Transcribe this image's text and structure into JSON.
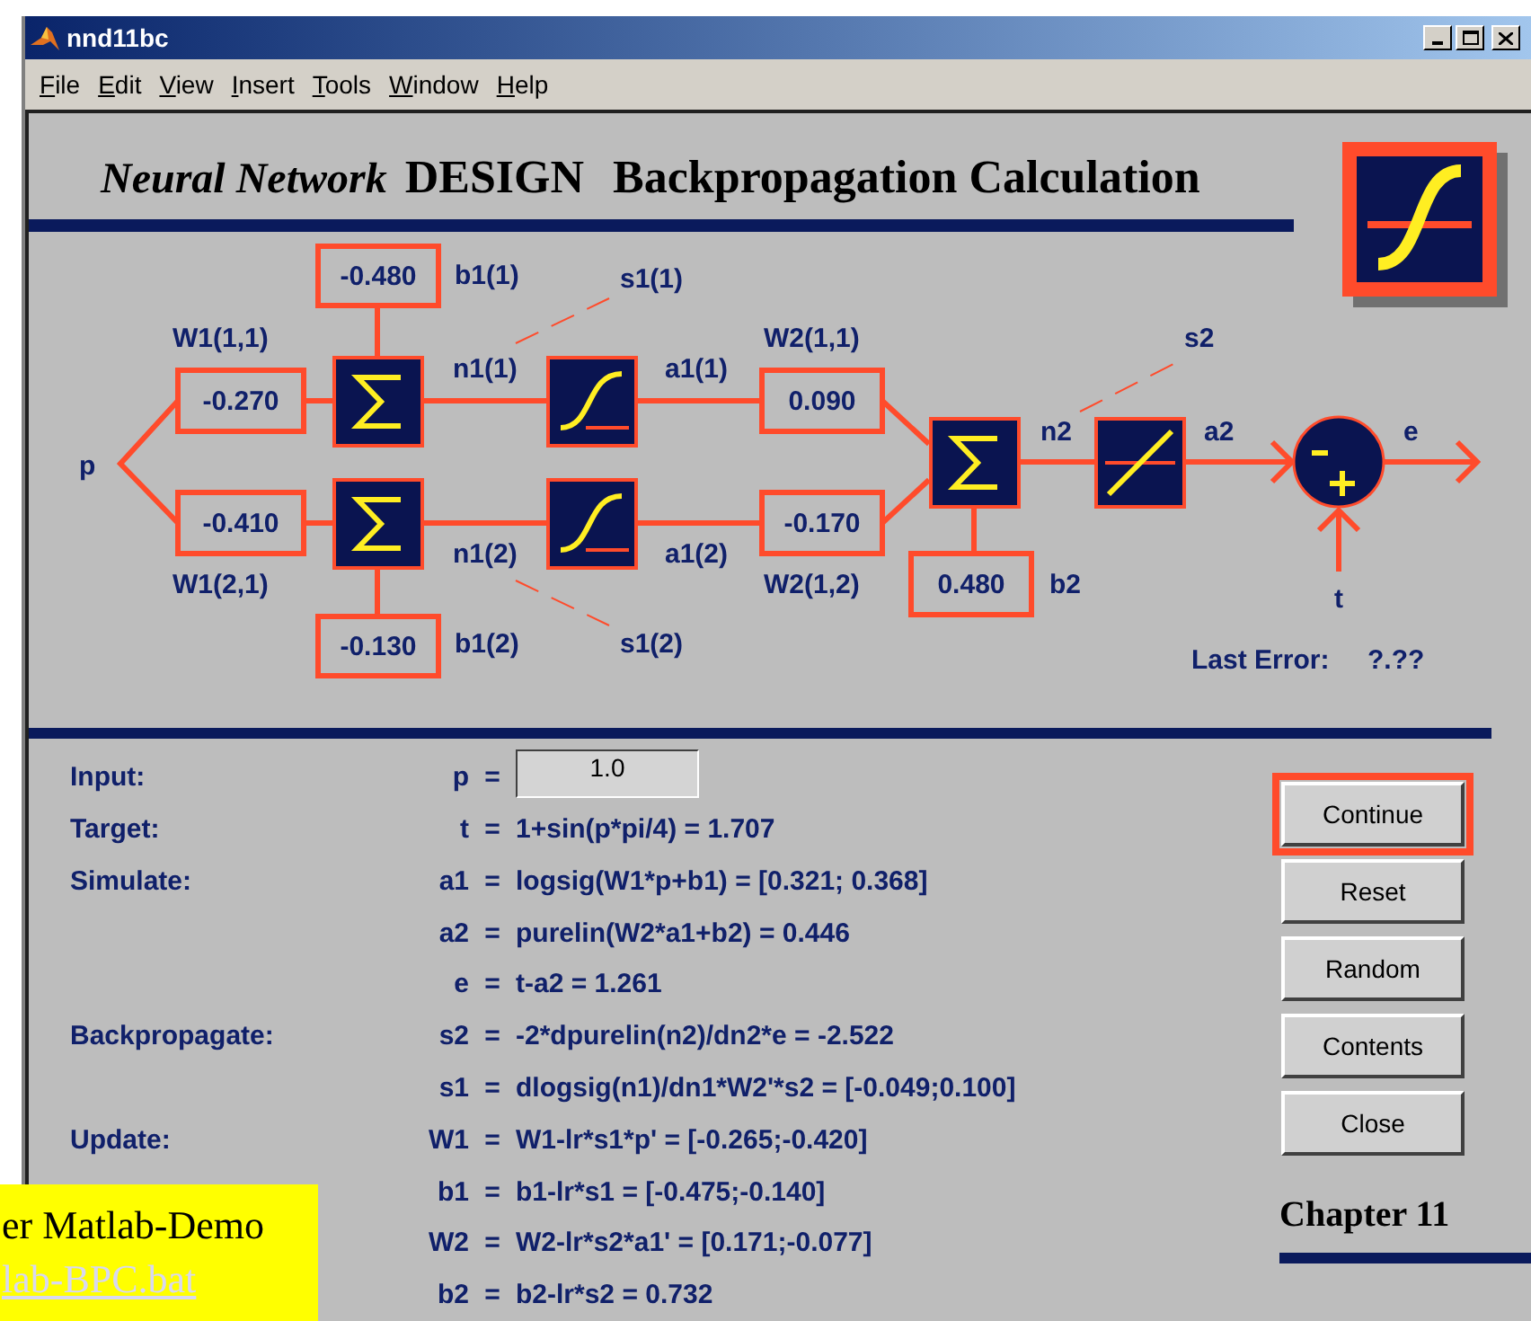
{
  "window": {
    "title": "nnd11bc"
  },
  "menu": [
    {
      "label": "File"
    },
    {
      "label": "Edit"
    },
    {
      "label": "View"
    },
    {
      "label": "Insert"
    },
    {
      "label": "Tools"
    },
    {
      "label": "Window"
    },
    {
      "label": "Help"
    }
  ],
  "header": {
    "title_italic": "Neural Network",
    "title_brand": "DESIGN",
    "subtitle": "Backpropagation Calculation"
  },
  "diagram": {
    "input_label": "p",
    "layer1": [
      {
        "weight_label": "W1(1,1)",
        "weight": "-0.270",
        "bias": "-0.480",
        "bias_label": "b1(1)",
        "net_label": "n1(1)",
        "sensitivity_label": "s1(1)",
        "output_label": "a1(1)"
      },
      {
        "weight_label": "W1(2,1)",
        "weight": "-0.410",
        "bias": "-0.130",
        "bias_label": "b1(2)",
        "net_label": "n1(2)",
        "sensitivity_label": "s1(2)",
        "output_label": "a1(2)"
      }
    ],
    "layer2": {
      "weights": [
        {
          "label": "W2(1,1)",
          "value": "0.090"
        },
        {
          "label": "W2(1,2)",
          "value": "-0.170"
        }
      ],
      "bias": "0.480",
      "bias_label": "b2",
      "net_label": "n2",
      "sensitivity_label": "s2",
      "output_label": "a2"
    },
    "error_label": "e",
    "target_label": "t",
    "last_error": {
      "label": "Last Error:",
      "value": "?.??"
    }
  },
  "calculation": [
    {
      "section": "Input:",
      "lhs": "p",
      "sign": "=",
      "kind": "field",
      "value": "1.0"
    },
    {
      "section": "Target:",
      "lhs": "t",
      "sign": "=",
      "kind": "formula",
      "rhs": "1+sin(p*pi/4) = 1.707"
    },
    {
      "section": "Simulate:",
      "lhs": "a1",
      "sign": "=",
      "kind": "formula",
      "rhs": "logsig(W1*p+b1) = [0.321; 0.368]"
    },
    {
      "lhs": "a2",
      "sign": "=",
      "kind": "formula",
      "rhs": "purelin(W2*a1+b2) = 0.446"
    },
    {
      "lhs": "e",
      "sign": "=",
      "kind": "formula",
      "rhs": "t-a2 = 1.261"
    },
    {
      "section": "Backpropagate:",
      "lhs": "s2",
      "sign": "=",
      "kind": "formula",
      "rhs": "-2*dpurelin(n2)/dn2*e = -2.522"
    },
    {
      "lhs": "s1",
      "sign": "=",
      "kind": "formula",
      "rhs": "dlogsig(n1)/dn1*W2'*s2 = [-0.049;0.100]"
    },
    {
      "section": "Update:",
      "lhs": "W1",
      "sign": "=",
      "kind": "formula",
      "rhs": "W1-lr*s1*p' = [-0.265;-0.420]"
    },
    {
      "lhs": "b1",
      "sign": "=",
      "kind": "formula",
      "rhs": "b1-lr*s1 = [-0.475;-0.140]"
    },
    {
      "lhs": "W2",
      "sign": "=",
      "kind": "formula",
      "rhs": "W2-lr*s2*a1' = [0.171;-0.077]"
    },
    {
      "lhs": "b2",
      "sign": "=",
      "kind": "formula",
      "rhs": "b2-lr*s2 = 0.732"
    }
  ],
  "buttons": [
    {
      "label": "Continue",
      "selected": true
    },
    {
      "label": "Reset",
      "selected": false
    },
    {
      "label": "Random",
      "selected": false
    },
    {
      "label": "Contents",
      "selected": false
    },
    {
      "label": "Close",
      "selected": false
    }
  ],
  "chapter": "Chapter 11",
  "slide_overlay": {
    "lines": [
      {
        "text": "er Matlab-Demo",
        "kind": "text"
      },
      {
        "text": "lab-BPC.bat",
        "kind": "link"
      }
    ]
  }
}
